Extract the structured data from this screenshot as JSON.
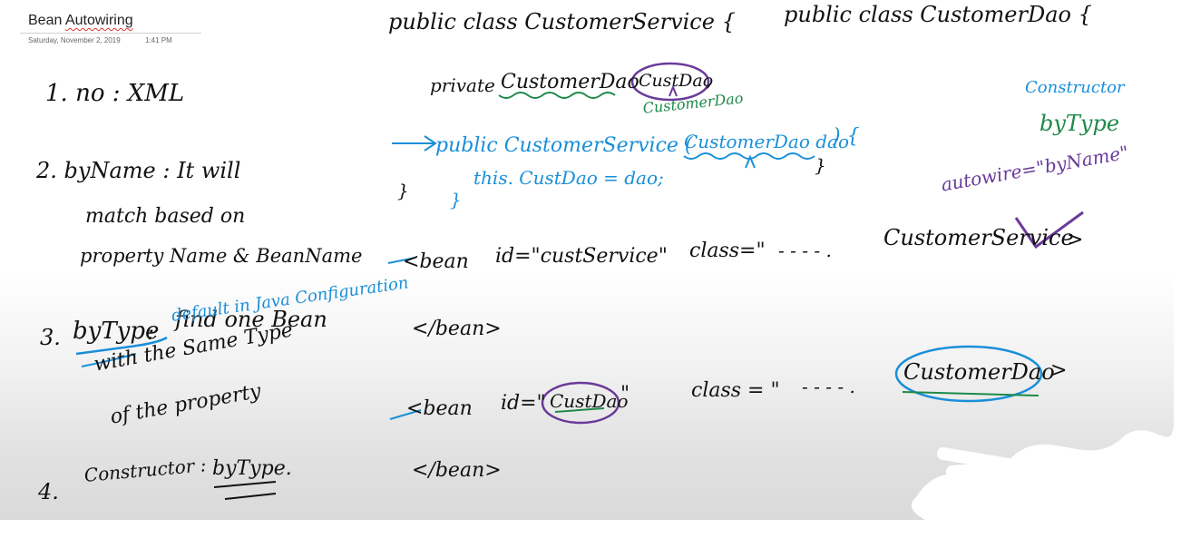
{
  "page": {
    "title_prefix": "Bean ",
    "title_misspelled": "Autowiring",
    "date": "Saturday, November 2, 2019",
    "time": "1:41 PM"
  },
  "notes_left": {
    "item1": "1. no : XML",
    "item2_line1": "2. byName : It will",
    "item2_line2": "match based on",
    "item2_line3": "property Name & BeanName",
    "item3_num": "3.",
    "item3_key": "byType",
    "item3_colon": ":",
    "item3_line1": "find one Bean",
    "item3_default": "default in Java Configuration",
    "item3_line2": "with the Same Type",
    "item3_line3": "of the property",
    "item4_num": "4.",
    "item4_label": "Constructor :",
    "item4_value": "byType."
  },
  "code": {
    "class_service": "public class CustomerService {",
    "private_kw": "private",
    "field_type": "CustomerDao",
    "field_name": "CustDao",
    "field_comma": ",",
    "annot_type": "CustomerDao",
    "ctor_pre": "public CustomerService (",
    "ctor_param": "CustomerDao dao",
    "ctor_post": ") {",
    "ctor_body": "this. CustDao = dao;",
    "ctor_close": "}",
    "class_close": "}",
    "dao_close": "}",
    "class_dao": "public class CustomerDao {",
    "bean1_pre": "<bean",
    "bean1_id": "id=\"custService\"",
    "bean1_class": "class=\"",
    "bean1_dots": "- - - - .",
    "bean1_name": "CustomerService",
    "bean1_end": ">",
    "bean1_close": "</bean>",
    "bean2_pre": "<bean",
    "bean2_id_pre": "id=\"",
    "bean2_id_val": "CustDao",
    "bean2_id_post": "\"",
    "bean2_class": "class = \"",
    "bean2_dots": "- - - - .",
    "bean2_name": "CustomerDao",
    "bean2_end": ">",
    "bean2_close": "</bean>"
  },
  "annotations": {
    "constructor": "Constructor",
    "by_type": "byType",
    "autowire": "autowire=\"byName\""
  },
  "colors": {
    "ink_black": "#111111",
    "ink_blue": "#1a8fd8",
    "ink_green": "#1d8a4a",
    "ink_purple": "#6a3a9a"
  }
}
